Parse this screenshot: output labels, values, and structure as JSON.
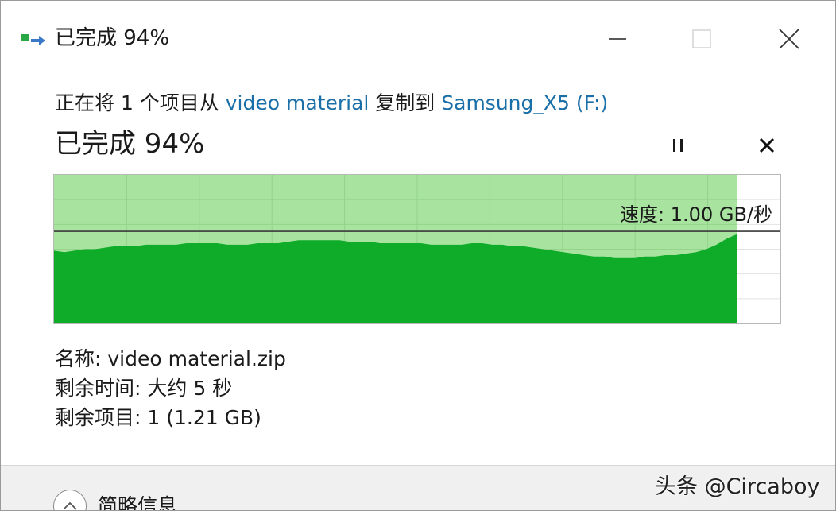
{
  "window": {
    "title": "已完成 94%"
  },
  "copy": {
    "desc_prefix": "正在将 1 个项目从 ",
    "source": "video material",
    "desc_middle": " 复制到 ",
    "destination": "Samsung_X5 (F:)",
    "status": "已完成 94%",
    "progress_percent": 94,
    "speed_label": "速度: 1.00 GB/秒"
  },
  "details": {
    "name_row": "名称: video material.zip",
    "time_row": "剩余时间: 大约 5 秒",
    "items_row": "剩余项目: 1 (1.21 GB)"
  },
  "footer": {
    "brief_label": "简略信息"
  },
  "watermark": {
    "text": "头条 @Circaboy"
  },
  "colors": {
    "graph_light": "#a8e3a0",
    "graph_dark": "#0fac2a",
    "link": "#1a6fa8"
  },
  "chart_data": {
    "type": "area",
    "progress_fraction": 0.94,
    "current_speed_fraction": 0.62,
    "values": [
      0.49,
      0.48,
      0.49,
      0.5,
      0.5,
      0.51,
      0.52,
      0.52,
      0.52,
      0.53,
      0.53,
      0.53,
      0.53,
      0.54,
      0.54,
      0.54,
      0.54,
      0.53,
      0.53,
      0.53,
      0.54,
      0.54,
      0.54,
      0.55,
      0.56,
      0.56,
      0.56,
      0.56,
      0.56,
      0.55,
      0.55,
      0.55,
      0.54,
      0.54,
      0.54,
      0.54,
      0.54,
      0.53,
      0.53,
      0.53,
      0.53,
      0.54,
      0.54,
      0.53,
      0.53,
      0.52,
      0.52,
      0.51,
      0.5,
      0.49,
      0.48,
      0.47,
      0.46,
      0.45,
      0.45,
      0.44,
      0.44,
      0.44,
      0.45,
      0.45,
      0.46,
      0.46,
      0.47,
      0.48,
      0.5,
      0.53,
      0.57,
      0.6
    ]
  }
}
